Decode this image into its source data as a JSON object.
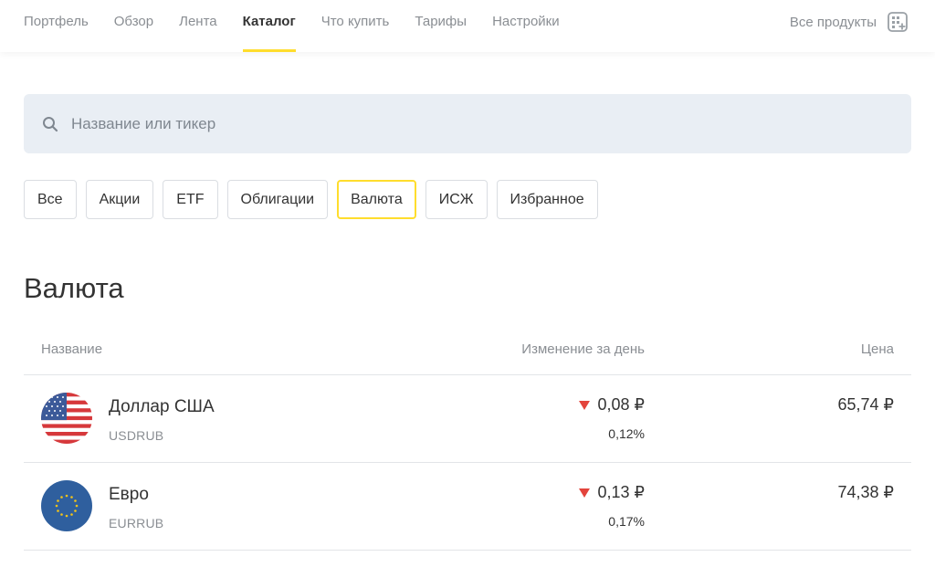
{
  "nav": {
    "tabs": [
      {
        "label": "Портфель",
        "active": false
      },
      {
        "label": "Обзор",
        "active": false
      },
      {
        "label": "Лента",
        "active": false
      },
      {
        "label": "Каталог",
        "active": true
      },
      {
        "label": "Что купить",
        "active": false
      },
      {
        "label": "Тарифы",
        "active": false
      },
      {
        "label": "Настройки",
        "active": false
      }
    ],
    "all_products_label": "Все продукты",
    "all_products_icon": "grid-plus-icon"
  },
  "search": {
    "placeholder": "Название или тикер",
    "value": "",
    "icon": "search-icon"
  },
  "filters": [
    {
      "label": "Все",
      "active": false
    },
    {
      "label": "Акции",
      "active": false
    },
    {
      "label": "ETF",
      "active": false
    },
    {
      "label": "Облигации",
      "active": false
    },
    {
      "label": "Валюта",
      "active": true
    },
    {
      "label": "ИСЖ",
      "active": false
    },
    {
      "label": "Избранное",
      "active": false
    }
  ],
  "page_title": "Валюта",
  "table": {
    "headers": {
      "name": "Название",
      "change": "Изменение за день",
      "price": "Цена"
    },
    "rows": [
      {
        "name": "Доллар США",
        "ticker": "USDRUB",
        "change": "0,08 ₽",
        "change_pct": "0,12%",
        "price": "65,74 ₽",
        "direction": "down",
        "icon": "us-flag-icon"
      },
      {
        "name": "Евро",
        "ticker": "EURRUB",
        "change": "0,13 ₽",
        "change_pct": "0,17%",
        "price": "74,38 ₽",
        "direction": "down",
        "icon": "eu-flag-icon"
      }
    ]
  },
  "colors": {
    "accent": "#ffdd2d",
    "negative": "#e3443c",
    "search_bg": "#e9eef4",
    "muted_text": "#8a8e93"
  }
}
